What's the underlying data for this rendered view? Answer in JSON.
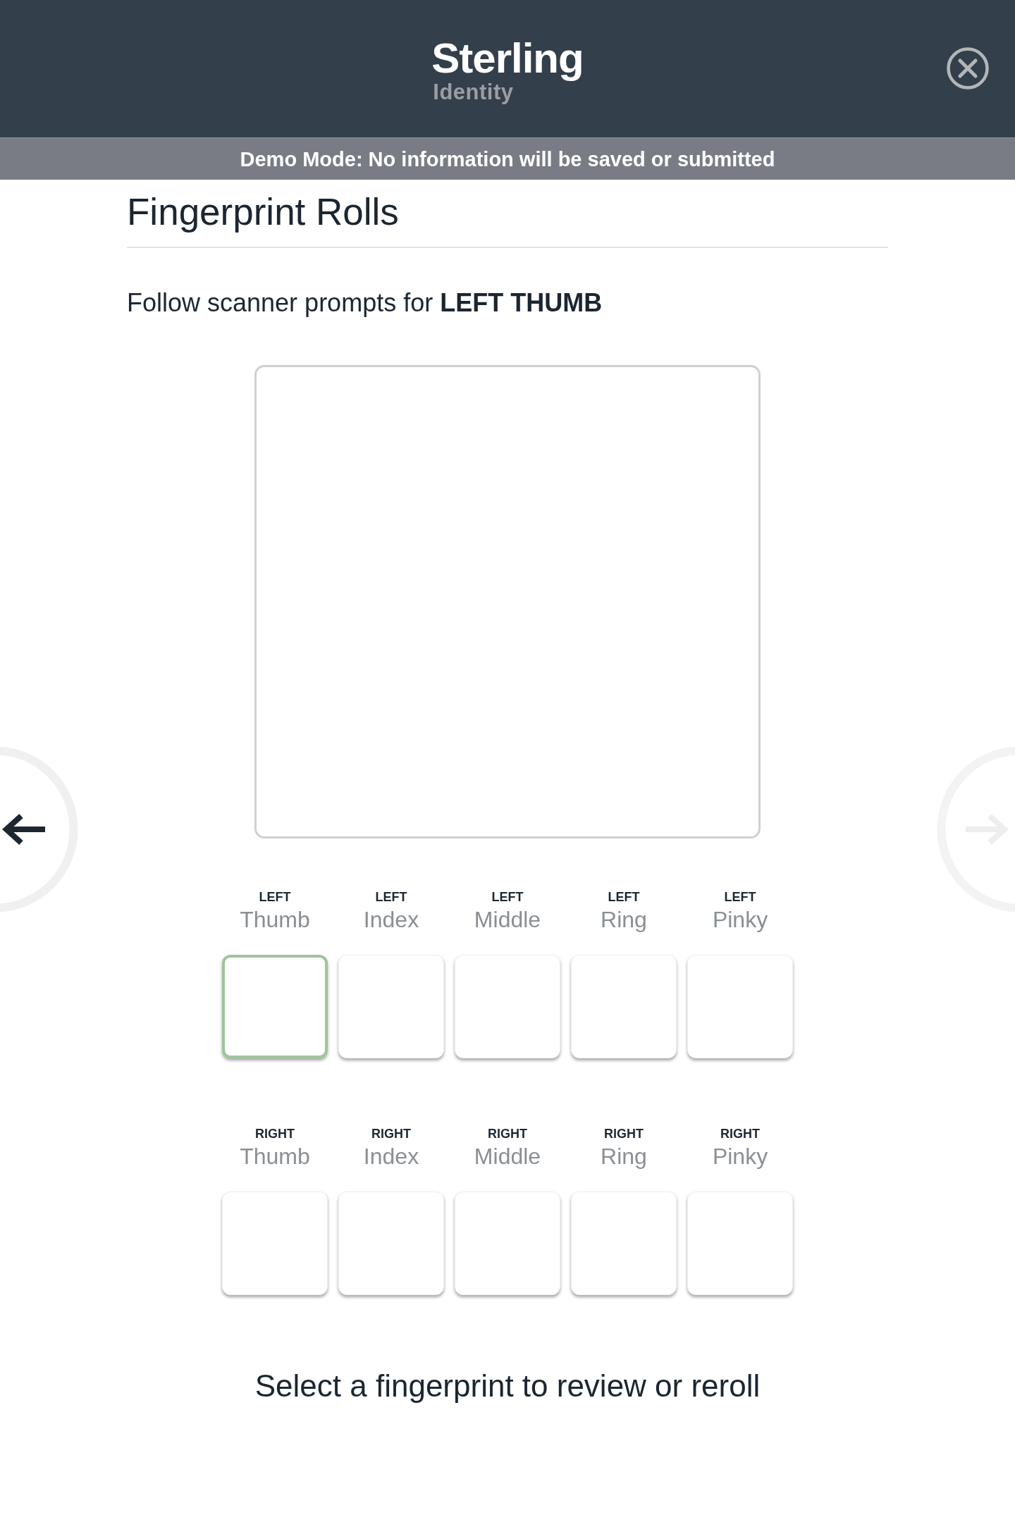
{
  "header": {
    "brand": {
      "name": "Sterling",
      "tagline": "Identity"
    }
  },
  "banner": {
    "text": "Demo Mode: No information will be saved or submitted"
  },
  "title": "Fingerprint Rolls",
  "prompt": "Follow scanner prompts for **LEFT THUMB**",
  "navigation": {
    "previous": {
      "disabled": false
    },
    "next": {
      "disabled": true
    }
  },
  "finger_rows": [
    {
      "fingers": [
        {
          "side": "LEFT",
          "name": "Thumb",
          "selected": true
        },
        {
          "side": "LEFT",
          "name": "Index",
          "selected": false
        },
        {
          "side": "LEFT",
          "name": "Middle",
          "selected": false
        },
        {
          "side": "LEFT",
          "name": "Ring",
          "selected": false
        },
        {
          "side": "LEFT",
          "name": "Pinky",
          "selected": false
        }
      ]
    },
    {
      "fingers": [
        {
          "side": "RIGHT",
          "name": "Thumb",
          "selected": false
        },
        {
          "side": "RIGHT",
          "name": "Index",
          "selected": false
        },
        {
          "side": "RIGHT",
          "name": "Middle",
          "selected": false
        },
        {
          "side": "RIGHT",
          "name": "Ring",
          "selected": false
        },
        {
          "side": "RIGHT",
          "name": "Pinky",
          "selected": false
        }
      ]
    }
  ],
  "footer_hint": "Select a fingerprint to review or reroll"
}
